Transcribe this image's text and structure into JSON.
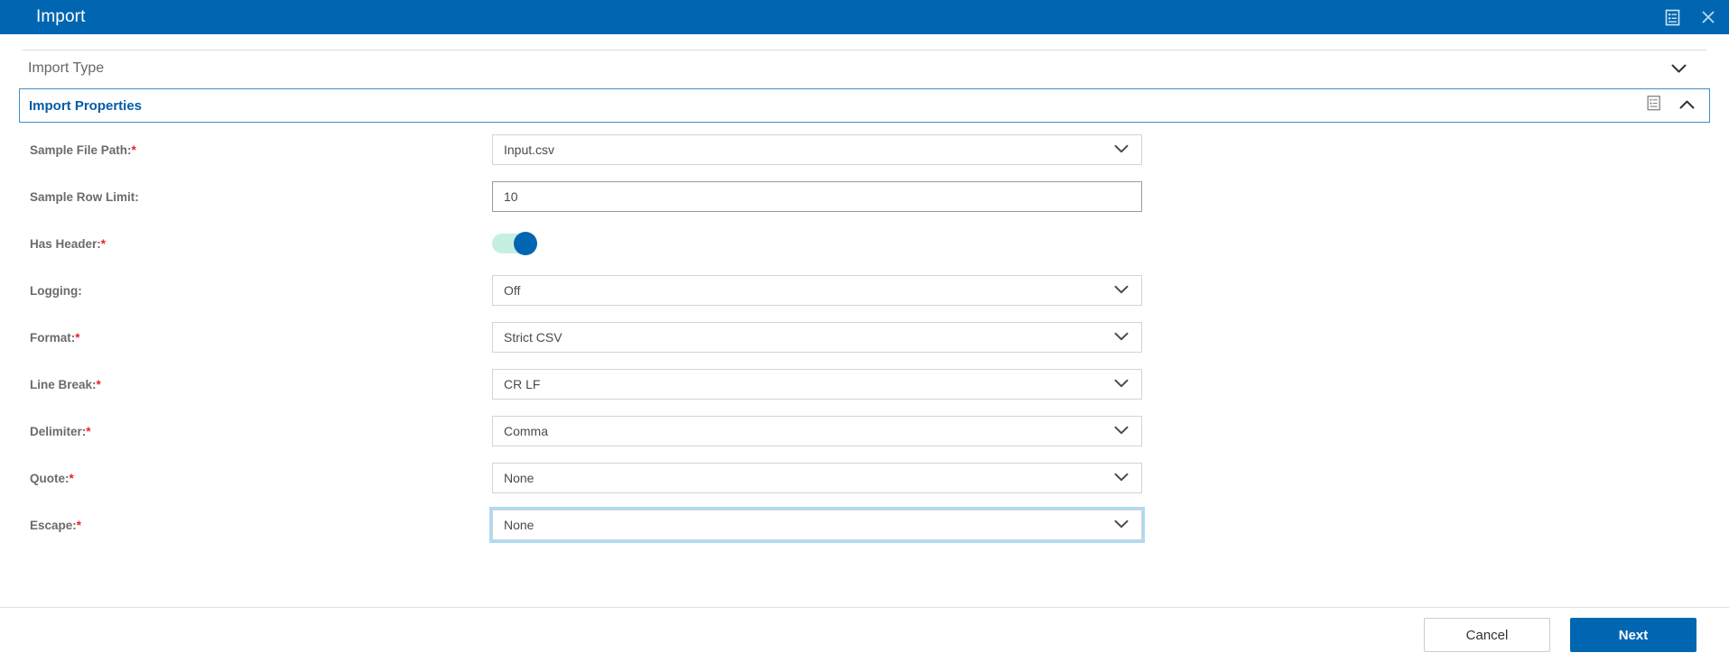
{
  "window": {
    "title": "Import",
    "actions": [
      {
        "name": "notes-icon",
        "icon": "note-list-icon"
      },
      {
        "name": "close-icon",
        "icon": "close-icon"
      }
    ]
  },
  "sections": {
    "import_type": {
      "label": "Import Type",
      "expanded": false,
      "chevron": "chevron-down-icon"
    },
    "import_properties": {
      "label": "Import Properties",
      "expanded": true,
      "chevron": "chevron-up-icon",
      "note_icon": "note-list-icon"
    }
  },
  "form": {
    "rows": [
      {
        "label": "Sample File Path:",
        "required": true,
        "type": "select",
        "value": "Input.csv",
        "focused": false
      },
      {
        "label": "Sample Row Limit:",
        "required": false,
        "type": "input",
        "value": "10",
        "focused": false
      },
      {
        "label": "Has Header:",
        "required": true,
        "type": "toggle",
        "value": "on",
        "focused": false
      },
      {
        "label": "Logging:",
        "required": false,
        "type": "select",
        "value": "Off",
        "focused": false
      },
      {
        "label": "Format:",
        "required": true,
        "type": "select",
        "value": "Strict CSV",
        "focused": false
      },
      {
        "label": "Line Break:",
        "required": true,
        "type": "select",
        "value": "CR LF",
        "focused": false
      },
      {
        "label": "Delimiter:",
        "required": true,
        "type": "select",
        "value": "Comma",
        "focused": false
      },
      {
        "label": "Quote:",
        "required": true,
        "type": "select",
        "value": "None",
        "focused": false
      },
      {
        "label": "Escape:",
        "required": true,
        "type": "select",
        "value": "None",
        "focused": true
      }
    ]
  },
  "footer": {
    "cancel_label": "Cancel",
    "next_label": "Next"
  },
  "colors": {
    "brand_blue": "#0066b2",
    "section_blue": "#005ca8",
    "required_red": "#e8212b",
    "toggle_track_on": "#c5f0e1",
    "toggle_knob_on": "#0066b2",
    "focus_ring": "#addaf5"
  }
}
